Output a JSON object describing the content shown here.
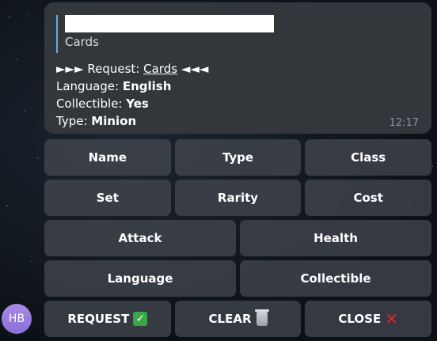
{
  "message": {
    "reply_preview_text": "Cards",
    "request_prefix": "►►► Request: ",
    "request_value": "Cards",
    "request_suffix": " ◄◄◄",
    "fields": [
      {
        "label": "Language: ",
        "value": "English"
      },
      {
        "label": "Collectible: ",
        "value": "Yes"
      },
      {
        "label": "Type: ",
        "value": "Minion"
      }
    ],
    "time": "12:17"
  },
  "keyboard": {
    "rows": [
      [
        "Name",
        "Type",
        "Class"
      ],
      [
        "Set",
        "Rarity",
        "Cost"
      ],
      [
        "Attack",
        "Health"
      ],
      [
        "Language",
        "Collectible"
      ]
    ],
    "actions": {
      "request": {
        "label": "REQUEST",
        "icon": "check-mark-icon",
        "color": "#3aa845"
      },
      "clear": {
        "label": "CLEAR",
        "icon": "trash-icon"
      },
      "close": {
        "label": "CLOSE",
        "icon": "cross-mark-icon",
        "color": "#e0232e"
      }
    }
  },
  "avatar": {
    "initials": "HB",
    "color": "#9a7ddf"
  },
  "colors": {
    "bubble": "#33373c",
    "accent": "#5eaee8",
    "timestamp": "#8d939b"
  }
}
